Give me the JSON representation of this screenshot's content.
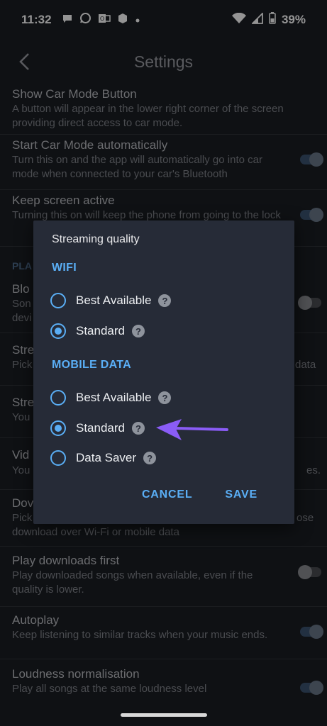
{
  "status_bar": {
    "time": "11:32",
    "notifications": [
      "chat-bubble-icon",
      "whatsapp-icon",
      "outlook-icon",
      "box-icon",
      "more-dot-icon"
    ],
    "battery": "39%"
  },
  "app_bar": {
    "title": "Settings"
  },
  "settings": [
    {
      "title": "Show Car Mode Button",
      "desc": "A button will appear in the lower right corner of the screen providing direct access to car mode.",
      "toggle": null
    },
    {
      "title": "Start Car Mode automatically",
      "desc": "Turn this on and the app will automatically go into car mode when connected to your car's Bluetooth",
      "toggle": "on"
    },
    {
      "title": "Keep screen active",
      "desc": "Turning this on will keep the phone from going to the lock",
      "toggle": "on"
    }
  ],
  "background_fragments": {
    "section_pla": "PLA",
    "blo": "Blo",
    "son": "Son",
    "devi": "devi",
    "stre1": "Stre",
    "pick1": "Pick",
    "data_tail": "data",
    "stre2": "Stre",
    "you1": "You",
    "vid": "Vid",
    "you2": "You",
    "es_tail": "es.",
    "dov": "Dov",
    "pick2": "Pick",
    "ose_tail": "ose",
    "download_line": "download over Wi-Fi or mobile data"
  },
  "settings_bottom": [
    {
      "title": "Play downloads first",
      "desc": "Play downloaded songs when available, even if the quality is lower.",
      "toggle": "off"
    },
    {
      "title": "Autoplay",
      "desc": "Keep listening to similar tracks when your music ends.",
      "toggle": "on"
    },
    {
      "title": "Loudness normalisation",
      "desc": "Play all songs at the same loudness level",
      "toggle": "on"
    }
  ],
  "dialog": {
    "title": "Streaming quality",
    "wifi_label": "WIFI",
    "wifi_options": [
      {
        "label": "Best Available",
        "checked": false
      },
      {
        "label": "Standard",
        "checked": true
      }
    ],
    "mobile_label": "MOBILE DATA",
    "mobile_options": [
      {
        "label": "Best Available",
        "checked": false
      },
      {
        "label": "Standard",
        "checked": true
      },
      {
        "label": "Data Saver",
        "checked": false
      }
    ],
    "help_glyph": "?",
    "cancel_label": "CANCEL",
    "save_label": "SAVE"
  },
  "colors": {
    "accent": "#5aaef5",
    "arrow": "#8a5cf6",
    "dialog_bg": "#262b37"
  }
}
